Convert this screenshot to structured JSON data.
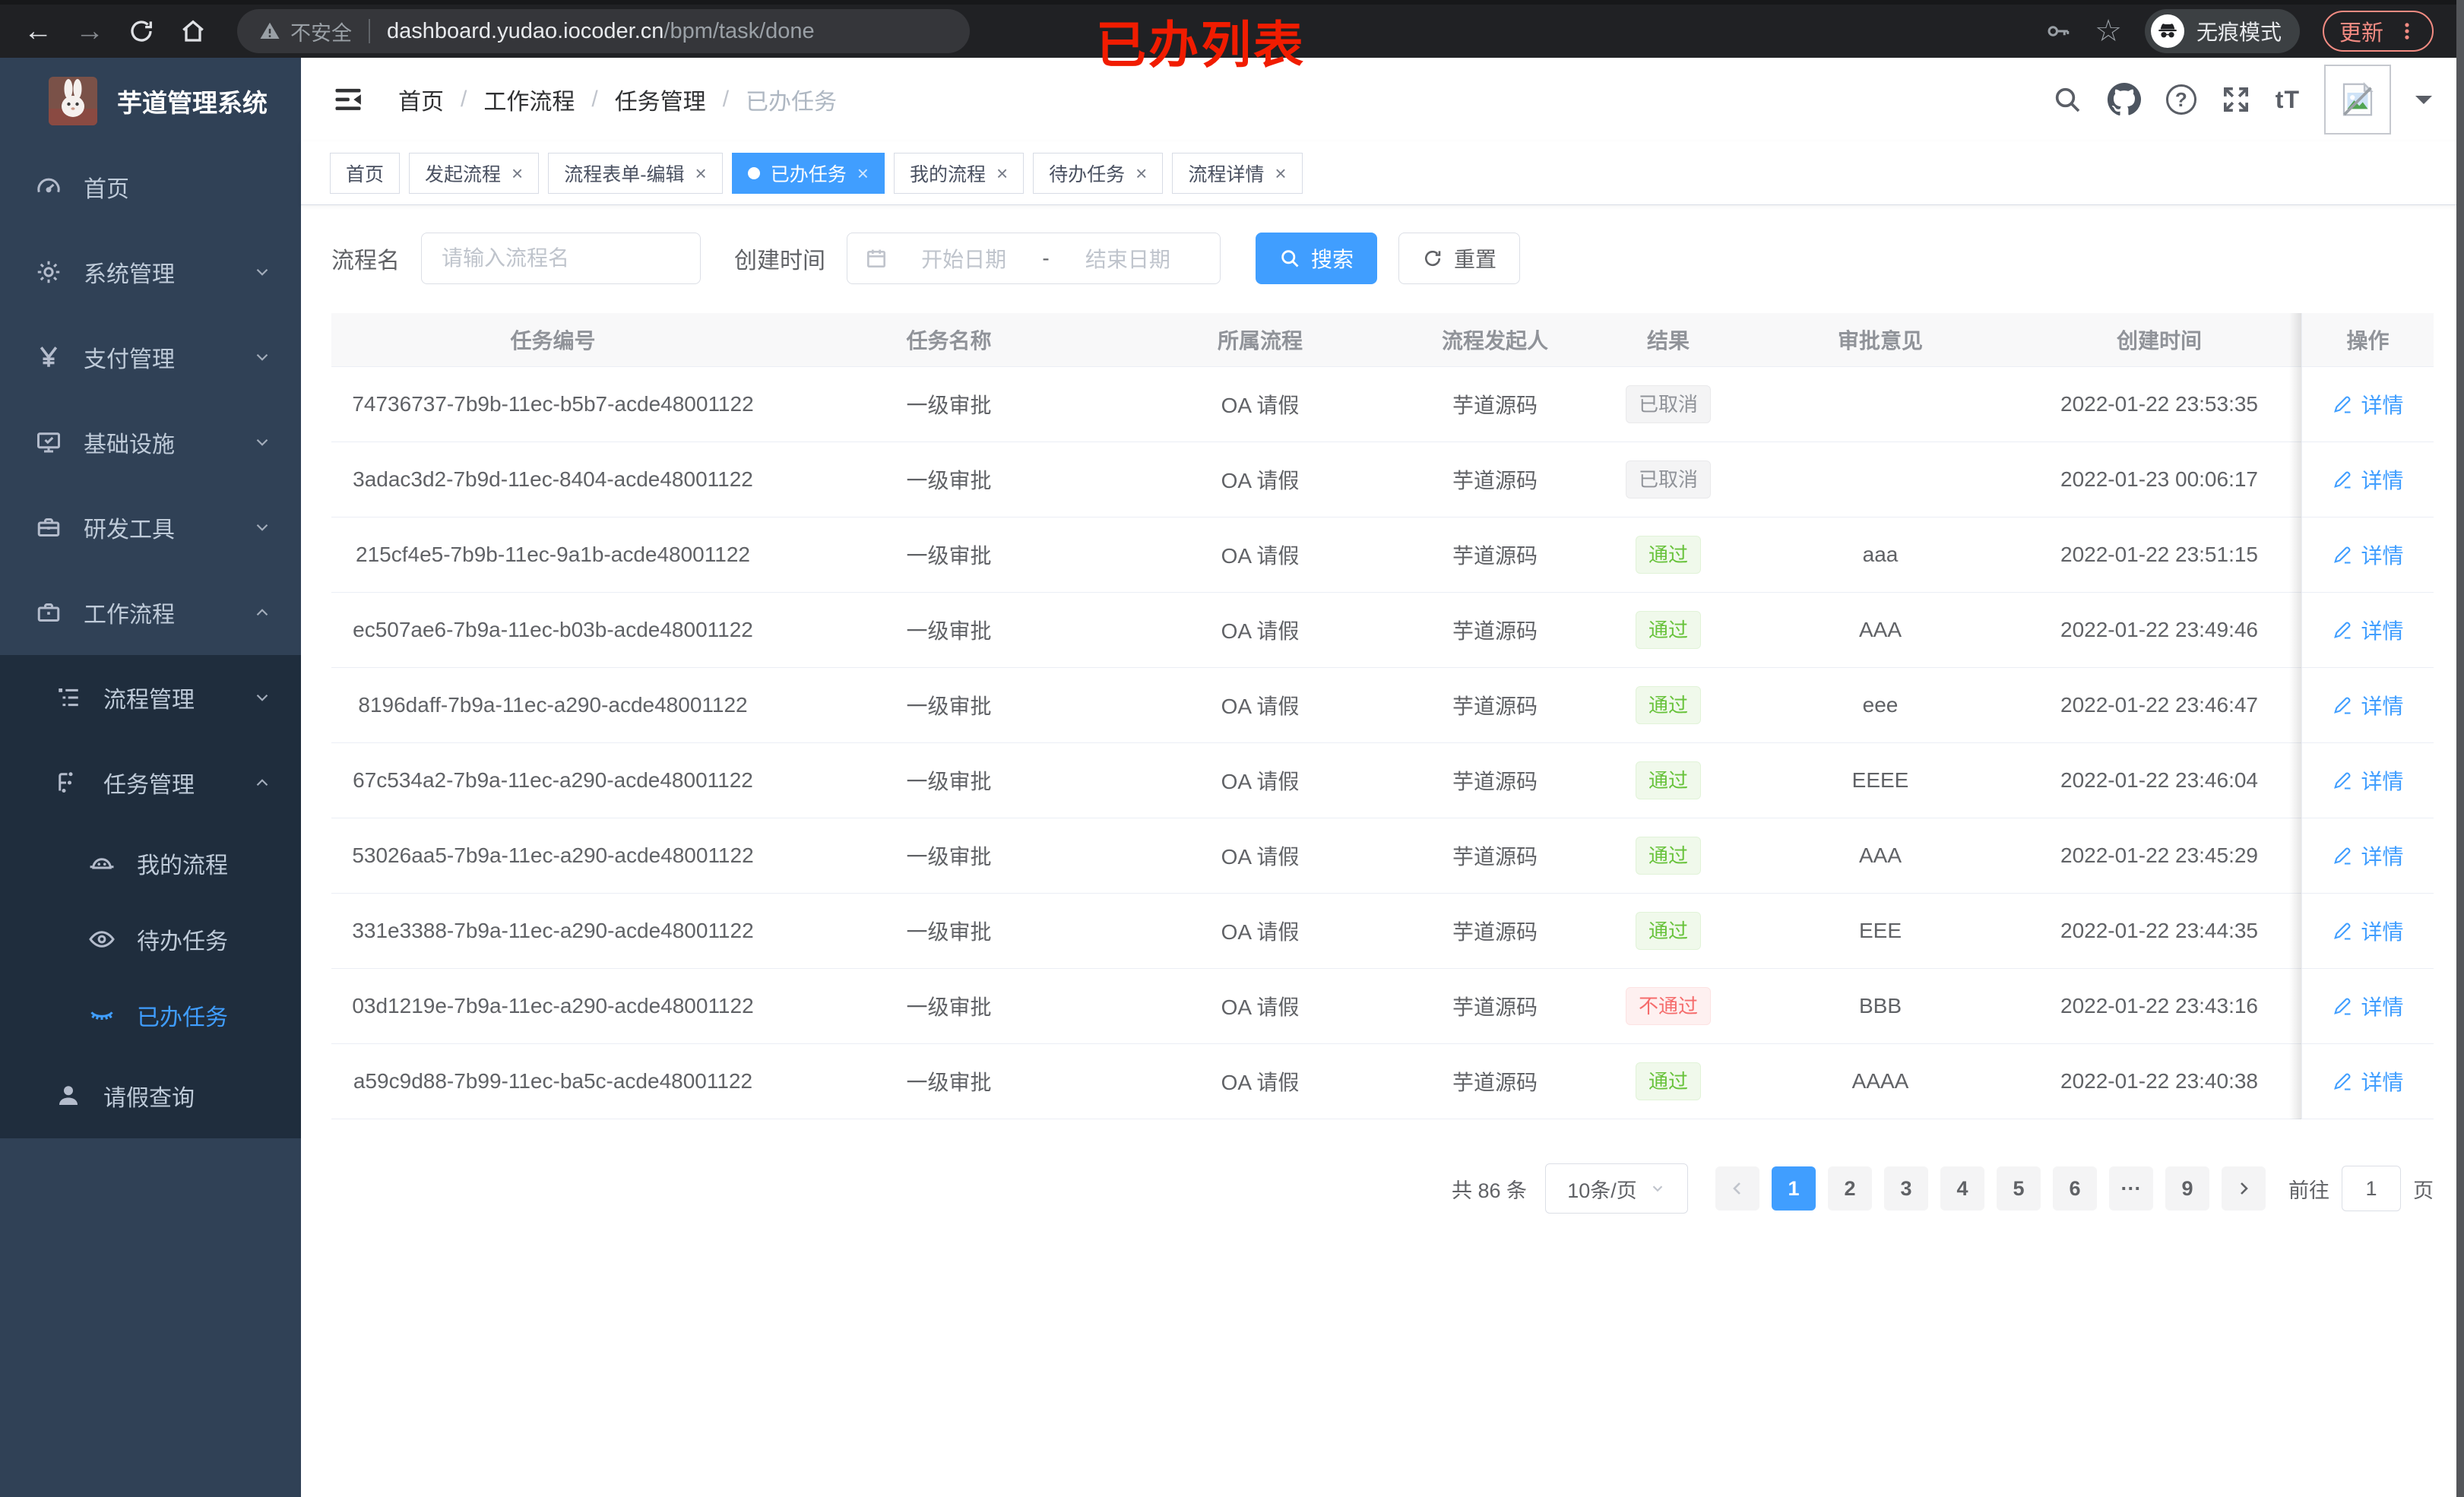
{
  "icons": {
    "back": "←",
    "forward": "→",
    "star": "☆",
    "help": "?",
    "font_size": "tT",
    "close": "×",
    "breadcrumb_separator": "/",
    "date_separator": "-"
  },
  "browser": {
    "security_label": "不安全",
    "url_host": "dashboard.yudao.iocoder.cn",
    "url_path": "/bpm/task/done",
    "annotation": "已办列表",
    "incognito_label": "无痕模式",
    "update_label": "更新"
  },
  "sidebar": {
    "app_title": "芋道管理系统",
    "menu": {
      "home": "首页",
      "system": "系统管理",
      "payment": "支付管理",
      "infra": "基础设施",
      "devtools": "研发工具",
      "workflow": "工作流程",
      "process_mgmt": "流程管理",
      "task_mgmt": "任务管理",
      "my_process": "我的流程",
      "todo_tasks": "待办任务",
      "done_tasks": "已办任务",
      "leave_query": "请假查询"
    }
  },
  "header": {
    "breadcrumb": [
      "首页",
      "工作流程",
      "任务管理",
      "已办任务"
    ]
  },
  "tabs": [
    {
      "label": "首页"
    },
    {
      "label": "发起流程"
    },
    {
      "label": "流程表单-编辑"
    },
    {
      "label": "已办任务"
    },
    {
      "label": "我的流程"
    },
    {
      "label": "待办任务"
    },
    {
      "label": "流程详情"
    }
  ],
  "filters": {
    "process_name_label": "流程名",
    "process_name_placeholder": "请输入流程名",
    "create_time_label": "创建时间",
    "start_placeholder": "开始日期",
    "end_placeholder": "结束日期",
    "search_label": "搜索",
    "reset_label": "重置"
  },
  "table": {
    "columns": [
      "任务编号",
      "任务名称",
      "所属流程",
      "流程发起人",
      "结果",
      "审批意见",
      "创建时间",
      "操作"
    ],
    "detail_label": "详情",
    "rows": [
      {
        "id": "74736737-7b9b-11ec-b5b7-acde48001122",
        "name": "一级审批",
        "process": "OA 请假",
        "starter": "芋道源码",
        "result": "已取消",
        "opinion": "",
        "time": "2022-01-22 23:53:35"
      },
      {
        "id": "3adac3d2-7b9d-11ec-8404-acde48001122",
        "name": "一级审批",
        "process": "OA 请假",
        "starter": "芋道源码",
        "result": "已取消",
        "opinion": "",
        "time": "2022-01-23 00:06:17"
      },
      {
        "id": "215cf4e5-7b9b-11ec-9a1b-acde48001122",
        "name": "一级审批",
        "process": "OA 请假",
        "starter": "芋道源码",
        "result": "通过",
        "opinion": "aaa",
        "time": "2022-01-22 23:51:15"
      },
      {
        "id": "ec507ae6-7b9a-11ec-b03b-acde48001122",
        "name": "一级审批",
        "process": "OA 请假",
        "starter": "芋道源码",
        "result": "通过",
        "opinion": "AAA",
        "time": "2022-01-22 23:49:46"
      },
      {
        "id": "8196daff-7b9a-11ec-a290-acde48001122",
        "name": "一级审批",
        "process": "OA 请假",
        "starter": "芋道源码",
        "result": "通过",
        "opinion": "eee",
        "time": "2022-01-22 23:46:47"
      },
      {
        "id": "67c534a2-7b9a-11ec-a290-acde48001122",
        "name": "一级审批",
        "process": "OA 请假",
        "starter": "芋道源码",
        "result": "通过",
        "opinion": "EEEE",
        "time": "2022-01-22 23:46:04"
      },
      {
        "id": "53026aa5-7b9a-11ec-a290-acde48001122",
        "name": "一级审批",
        "process": "OA 请假",
        "starter": "芋道源码",
        "result": "通过",
        "opinion": "AAA",
        "time": "2022-01-22 23:45:29"
      },
      {
        "id": "331e3388-7b9a-11ec-a290-acde48001122",
        "name": "一级审批",
        "process": "OA 请假",
        "starter": "芋道源码",
        "result": "通过",
        "opinion": "EEE",
        "time": "2022-01-22 23:44:35"
      },
      {
        "id": "03d1219e-7b9a-11ec-a290-acde48001122",
        "name": "一级审批",
        "process": "OA 请假",
        "starter": "芋道源码",
        "result": "不通过",
        "opinion": "BBB",
        "time": "2022-01-22 23:43:16"
      },
      {
        "id": "a59c9d88-7b99-11ec-ba5c-acde48001122",
        "name": "一级审批",
        "process": "OA 请假",
        "starter": "芋道源码",
        "result": "通过",
        "opinion": "AAAA",
        "time": "2022-01-22 23:40:38"
      }
    ]
  },
  "pagination": {
    "total": "共 86 条",
    "page_size": "10条/页",
    "pages": [
      "1",
      "2",
      "3",
      "4",
      "5",
      "6"
    ],
    "ellipsis": "···",
    "last_page": "9",
    "goto_label": "前往",
    "goto_value": "1",
    "goto_unit": "页"
  }
}
